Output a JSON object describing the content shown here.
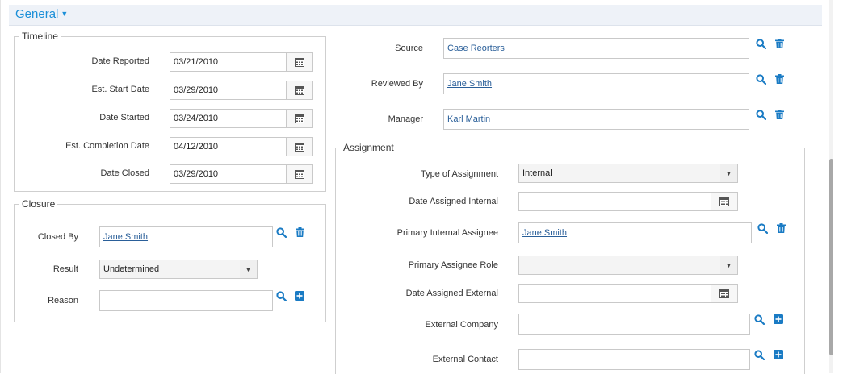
{
  "section": {
    "title": "General"
  },
  "timeline": {
    "legend": "Timeline",
    "date_reported": {
      "label": "Date Reported",
      "value": "03/21/2010"
    },
    "est_start_date": {
      "label": "Est. Start Date",
      "value": "03/29/2010"
    },
    "date_started": {
      "label": "Date Started",
      "value": "03/24/2010"
    },
    "est_completion_date": {
      "label": "Est. Completion Date",
      "value": "04/12/2010"
    },
    "date_closed": {
      "label": "Date Closed",
      "value": "03/29/2010"
    }
  },
  "closure": {
    "legend": "Closure",
    "closed_by": {
      "label": "Closed By",
      "value": "Jane Smith"
    },
    "result": {
      "label": "Result",
      "value": "Undetermined"
    },
    "reason": {
      "label": "Reason",
      "value": ""
    }
  },
  "people": {
    "source": {
      "label": "Source",
      "value": "Case Reorters"
    },
    "reviewed_by": {
      "label": "Reviewed By",
      "value": "Jane Smith"
    },
    "manager": {
      "label": "Manager",
      "value": "Karl Martin"
    }
  },
  "assignment": {
    "legend": "Assignment",
    "type_of_assignment": {
      "label": "Type of Assignment",
      "value": "Internal"
    },
    "date_assigned_internal": {
      "label": "Date Assigned Internal",
      "value": ""
    },
    "primary_internal_assignee": {
      "label": "Primary Internal Assignee",
      "value": "Jane Smith"
    },
    "primary_assignee_role": {
      "label": "Primary Assignee Role",
      "value": ""
    },
    "date_assigned_external": {
      "label": "Date Assigned External",
      "value": ""
    },
    "external_company": {
      "label": "External Company",
      "value": ""
    },
    "external_contact": {
      "label": "External Contact",
      "value": ""
    }
  },
  "icons": {
    "search": "search-icon",
    "delete": "trash-icon",
    "add": "plus-square-icon",
    "calendar": "calendar-icon",
    "dropdown": "caret-down-icon"
  },
  "colors": {
    "accent": "#1a8fd8",
    "link": "#2a5f99",
    "header_bg": "#eef2f8",
    "border": "#cfcfcf"
  }
}
